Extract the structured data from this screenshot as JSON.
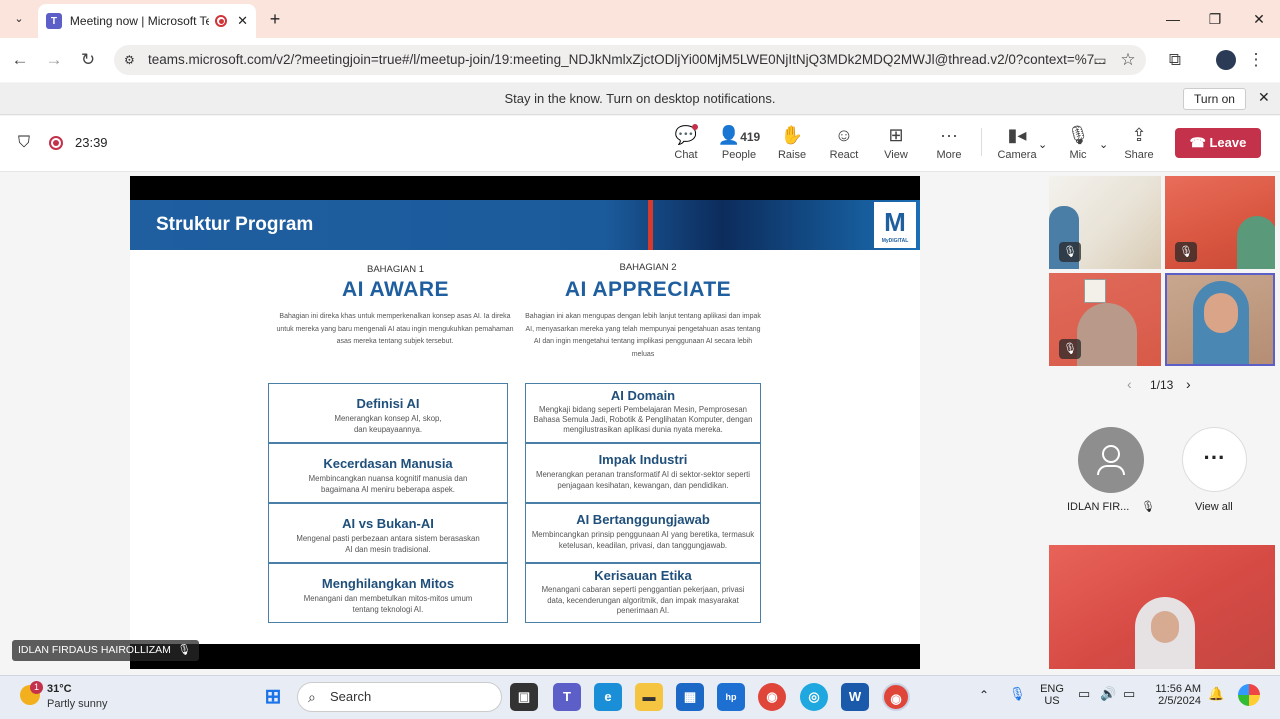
{
  "browser": {
    "tab_title": "Meeting now | Microsoft Te",
    "url": "teams.microsoft.com/v2/?meetingjoin=true#/l/meetup-join/19:meeting_NDJkNmlxZjctODljYi00MjM5LWE0NjItNjQ3MDk2MDQ2MWJl@thread.v2/0?context=%7...",
    "notification": "Stay in the know. Turn on desktop notifications.",
    "turn_on": "Turn on"
  },
  "toolbar": {
    "timer": "23:39",
    "chat": "Chat",
    "people_count": "419",
    "people": "People",
    "raise": "Raise",
    "react": "React",
    "view": "View",
    "more": "More",
    "camera": "Camera",
    "mic": "Mic",
    "share": "Share",
    "leave": "Leave"
  },
  "slide": {
    "title": "Struktur Program",
    "logo_text": "MyDIGITAL",
    "left": {
      "part": "BAHAGIAN 1",
      "title": "AI AWARE",
      "desc": "Bahagian ini direka khas untuk memperkenalkan konsep asas AI. Ia direka untuk mereka yang baru mengenali AI atau ingin mengukuhkan pemahaman asas mereka tentang subjek tersebut.",
      "boxes": [
        {
          "title": "Definisi AI",
          "desc": "Menerangkan konsep AI, skop, dan keupayaannya."
        },
        {
          "title": "Kecerdasan Manusia",
          "desc": "Membincangkan nuansa kognitif manusia dan bagaimana AI meniru beberapa aspek."
        },
        {
          "title": "AI vs Bukan-AI",
          "desc": "Mengenal pasti perbezaan antara sistem berasaskan AI dan mesin tradisional."
        },
        {
          "title": "Menghilangkan Mitos",
          "desc": "Menangani dan membetulkan mitos-mitos umum tentang teknologi AI."
        }
      ]
    },
    "right": {
      "part": "BAHAGIAN 2",
      "title": "AI APPRECIATE",
      "desc": "Bahagian ini akan mengupas dengan lebih lanjut tentang aplikasi dan impak AI, menyasarkan mereka yang telah mempunyai pengetahuan asas tentang AI dan ingin mengetahui tentang implikasi penggunaan AI secara lebih meluas",
      "boxes": [
        {
          "title": "AI Domain",
          "desc": "Mengkaji bidang seperti Pembelajaran Mesin, Pemprosesan Bahasa Semula Jadi, Robotik & Penglihatan Komputer, dengan mengilustrasikan aplikasi dunia nyata mereka."
        },
        {
          "title": "Impak Industri",
          "desc": "Menerangkan peranan transformatif AI di sektor-sektor seperti penjagaan kesihatan, kewangan, dan pendidikan."
        },
        {
          "title": "AI Bertanggungjawab",
          "desc": "Membincangkan prinsip penggunaan AI yang beretika, termasuk ketelusan, keadilan, privasi, dan tanggungjawab."
        },
        {
          "title": "Kerisauan Etika",
          "desc": "Menangani cabaran seperti penggantian pekerjaan, privasi data, kecenderungan algoritmik, dan impak masyarakat penerimaan AI."
        }
      ]
    }
  },
  "presenter_name": "IDLAN FIRDAUS HAIROLLIZAM",
  "gallery": {
    "page": "1/13",
    "participant_name": "IDLAN FIR...",
    "view_all": "View all"
  },
  "taskbar": {
    "weather_temp": "31°C",
    "weather_desc": "Partly sunny",
    "weather_badge": "1",
    "search": "Search",
    "lang1": "ENG",
    "lang2": "US",
    "time": "11:56 AM",
    "date": "2/5/2024"
  }
}
